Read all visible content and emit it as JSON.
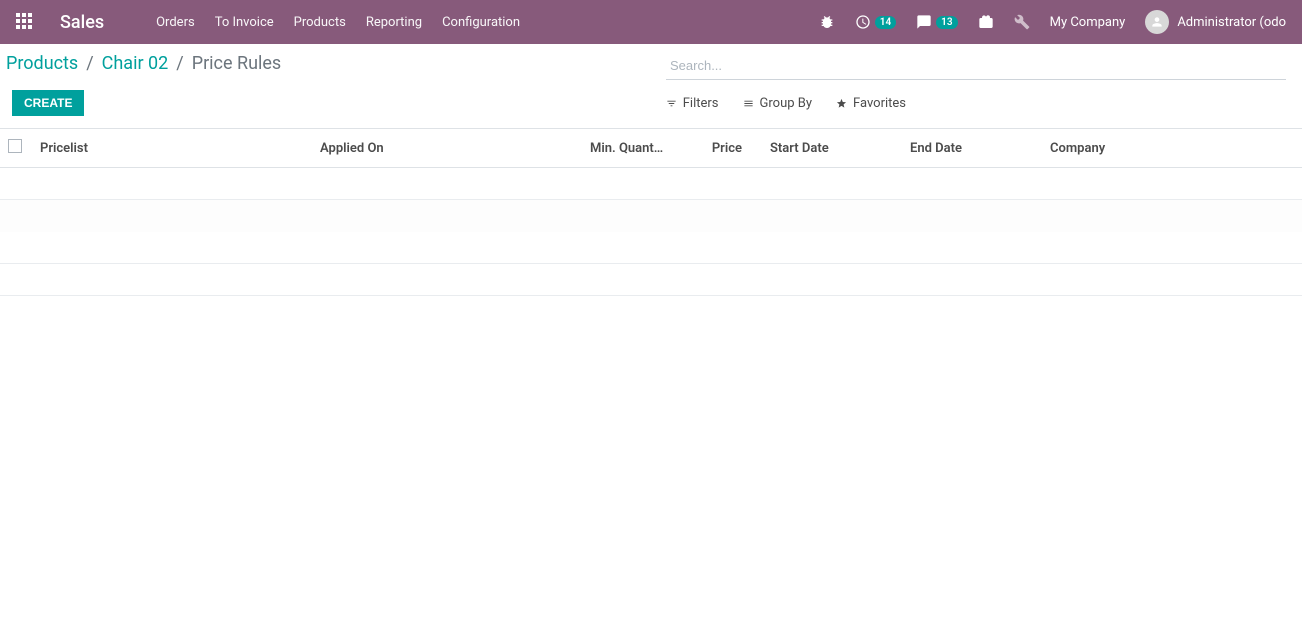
{
  "navbar": {
    "brand": "Sales",
    "menu": [
      "Orders",
      "To Invoice",
      "Products",
      "Reporting",
      "Configuration"
    ],
    "activities_badge": "14",
    "messages_badge": "13",
    "company": "My Company",
    "user": "Administrator (odo"
  },
  "breadcrumb": {
    "items": [
      "Products",
      "Chair 02"
    ],
    "current": "Price Rules"
  },
  "search": {
    "placeholder": "Search..."
  },
  "buttons": {
    "create": "CREATE",
    "filters": "Filters",
    "groupby": "Group By",
    "favorites": "Favorites"
  },
  "table": {
    "headers": {
      "pricelist": "Pricelist",
      "applied_on": "Applied On",
      "min_quant": "Min. Quant…",
      "price": "Price",
      "start_date": "Start Date",
      "end_date": "End Date",
      "company": "Company"
    }
  },
  "colors": {
    "accent": "#00a09d",
    "navbar": "#875a7b"
  }
}
